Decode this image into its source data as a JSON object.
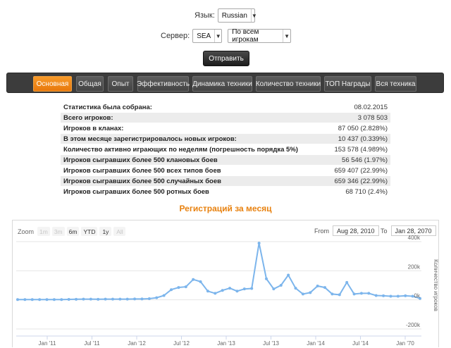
{
  "form": {
    "language_label": "Язык:",
    "language_value": "Russian",
    "server_label": "Сервер:",
    "server_value": "SEA",
    "players_value": "По всем игрокам",
    "submit_label": "Отправить"
  },
  "tabs": [
    {
      "label": "Основная",
      "active": true
    },
    {
      "label": "Общая"
    },
    {
      "label": "Опыт"
    },
    {
      "label": "Эффективность"
    },
    {
      "label": "Динамика техники"
    },
    {
      "label": "Количество техники"
    },
    {
      "label": "ТОП Награды"
    },
    {
      "label": "Вся техника"
    }
  ],
  "stats": [
    {
      "label": "Статистика была собрана:",
      "value": "08.02.2015"
    },
    {
      "label": "Всего игроков:",
      "value": "3 078 503"
    },
    {
      "label": "Игроков в кланах:",
      "value": "87 050 (2.828%)"
    },
    {
      "label": "В этом месяце зарегистрировалось новых игроков:",
      "value": "10 437 (0.339%)"
    },
    {
      "label": "Количество активно играющих по неделям (погрешность порядка 5%)",
      "value": "153 578 (4.989%)"
    },
    {
      "label": "Игроков сыгравших более 500 клановых боев",
      "value": "56 546 (1.97%)"
    },
    {
      "label": "Игроков сыгравших более 500 всех типов боев",
      "value": "659 407 (22.99%)"
    },
    {
      "label": "Игроков сыгравших более 500 случайных боев",
      "value": "659 346 (22.99%)"
    },
    {
      "label": "Игроков сыгравших более 500 ротных боев",
      "value": "68 710 (2.4%)"
    }
  ],
  "section_title": "Регистраций за месяц",
  "zoom": {
    "label": "Zoom",
    "buttons": [
      {
        "label": "1m",
        "disabled": true
      },
      {
        "label": "3m",
        "disabled": true
      },
      {
        "label": "6m"
      },
      {
        "label": "YTD"
      },
      {
        "label": "1y"
      },
      {
        "label": "All",
        "disabled": true
      }
    ]
  },
  "range": {
    "from_label": "From",
    "from_value": "Aug 28, 2010",
    "to_label": "To",
    "to_value": "Jan 28, 2070"
  },
  "chart_data": {
    "type": "line",
    "title": "",
    "xlabel": "",
    "ylabel": "Количество игроков",
    "ylim": [
      -200000,
      400000
    ],
    "y_ticks": [
      "400k",
      "200k",
      "0k",
      "-200k"
    ],
    "y_tick_values": [
      400000,
      200000,
      0,
      -200000
    ],
    "x_tick_labels": [
      "Jan '11",
      "Jul '11",
      "Jan '12",
      "Jul '12",
      "Jan '13",
      "Jul '13",
      "Jan '14",
      "Jul '14",
      "Jan '70"
    ],
    "grid": true,
    "color": "#7cb5ec",
    "series": [
      {
        "values": [
          2000,
          2000,
          2000,
          2000,
          2000,
          2000,
          2000,
          3000,
          4000,
          5000,
          5000,
          4000,
          5000,
          5000,
          5000,
          5000,
          6000,
          6000,
          8000,
          15000,
          30000,
          70000,
          85000,
          90000,
          140000,
          125000,
          60000,
          45000,
          65000,
          80000,
          60000,
          75000,
          78000,
          390000,
          145000,
          75000,
          100000,
          170000,
          80000,
          40000,
          50000,
          95000,
          85000,
          40000,
          35000,
          120000,
          40000,
          45000,
          45000,
          30000,
          28000,
          25000,
          25000,
          28000,
          25000,
          10000
        ]
      }
    ]
  }
}
